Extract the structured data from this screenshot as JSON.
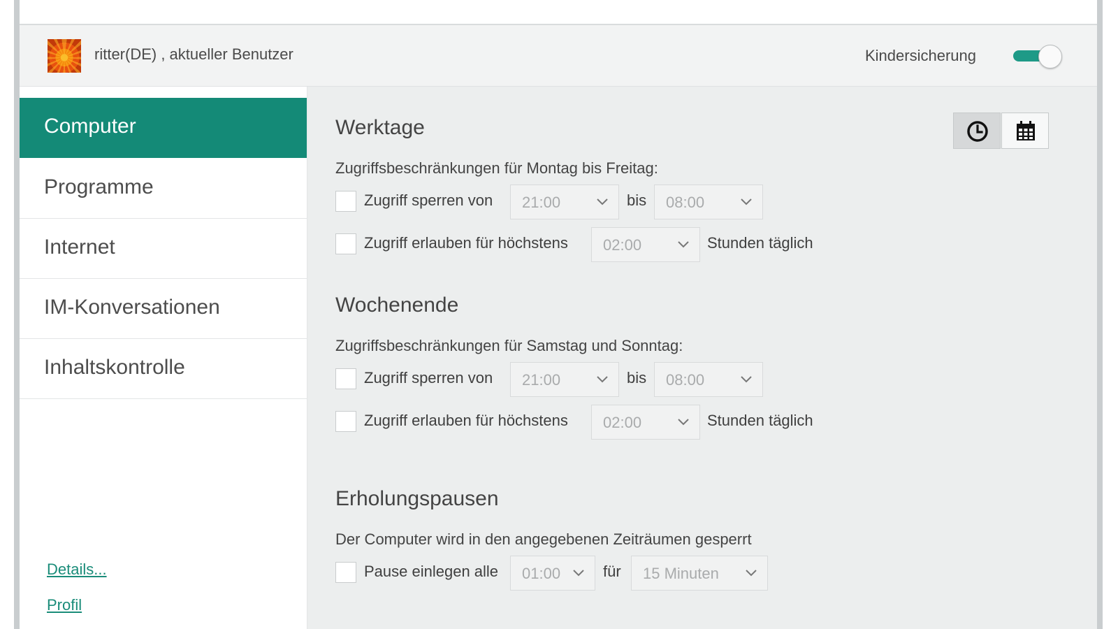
{
  "header": {
    "username": "ritter(DE) , aktueller Benutzer",
    "toggle_label": "Kindersicherung",
    "toggle_on": true
  },
  "sidebar": {
    "items": [
      {
        "label": "Computer",
        "active": true
      },
      {
        "label": "Programme",
        "active": false
      },
      {
        "label": "Internet",
        "active": false
      },
      {
        "label": "IM-Konversationen",
        "active": false
      },
      {
        "label": "Inhaltskontrolle",
        "active": false
      }
    ],
    "links": {
      "details": "Details...",
      "profile": "Profil"
    }
  },
  "view_buttons": {
    "clock": "clock-icon",
    "calendar": "calendar-icon"
  },
  "weekdays": {
    "title": "Werktage",
    "desc": "Zugriffsbeschränkungen für Montag bis Freitag:",
    "block": {
      "label": "Zugriff sperren von",
      "from": "21:00",
      "bis": "bis",
      "to": "08:00"
    },
    "allow": {
      "label": "Zugriff erlauben für höchstens",
      "value": "02:00",
      "suffix": "Stunden täglich"
    }
  },
  "weekend": {
    "title": "Wochenende",
    "desc": "Zugriffsbeschränkungen für Samstag und Sonntag:",
    "block": {
      "label": "Zugriff sperren von",
      "from": "21:00",
      "bis": "bis",
      "to": "08:00"
    },
    "allow": {
      "label": "Zugriff erlauben für höchstens",
      "value": "02:00",
      "suffix": "Stunden täglich"
    }
  },
  "breaks": {
    "title": "Erholungspausen",
    "desc": "Der Computer wird in den angegebenen Zeiträumen gesperrt",
    "label": "Pause einlegen alle",
    "every": "01:00",
    "fuer": "für",
    "duration": "15 Minuten"
  },
  "colors": {
    "accent": "#148a77",
    "toggle": "#1e9a87",
    "link": "#1a8c79"
  }
}
